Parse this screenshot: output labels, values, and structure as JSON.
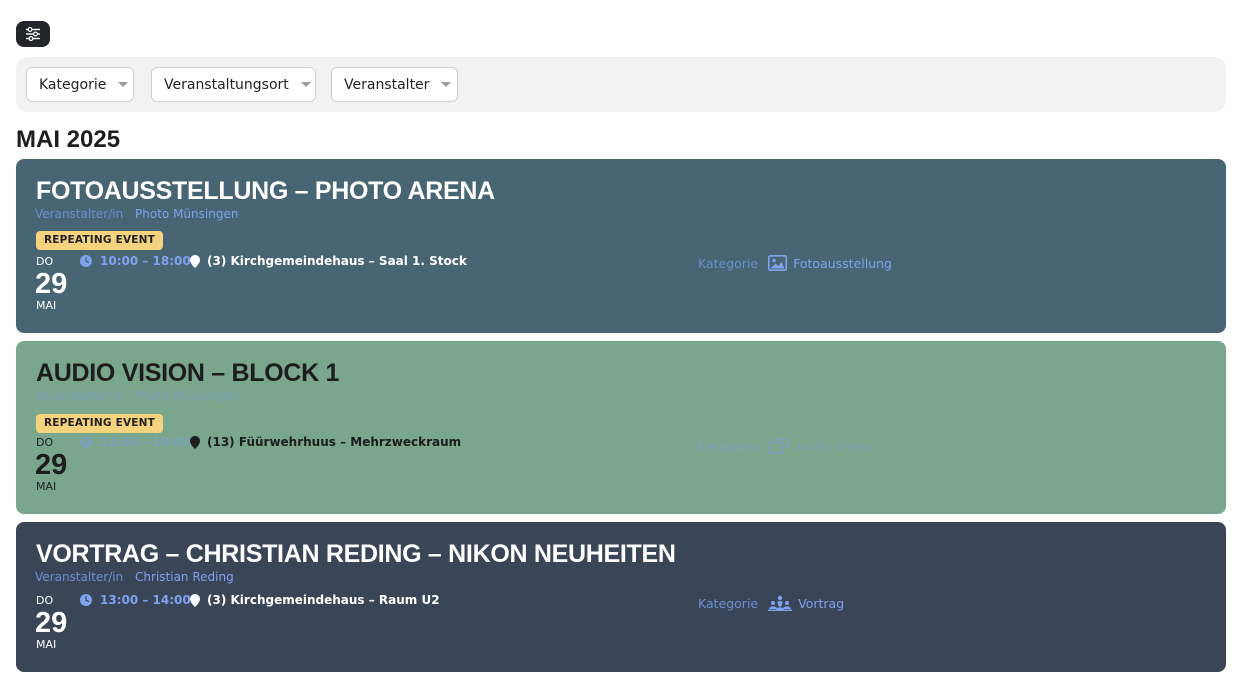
{
  "filters": {
    "toggle_icon": "sliders-icon",
    "dropdowns": [
      {
        "label": "Kategorie"
      },
      {
        "label": "Veranstaltungsort"
      },
      {
        "label": "Veranstalter"
      }
    ]
  },
  "month_title": "MAI 2025",
  "colors": {
    "card_1_bg": "#476573",
    "card_2_bg": "#7aa68d",
    "card_3_bg": "#3a4658",
    "badge_bg": "#f5d27e",
    "link": "#7fa3ef"
  },
  "events": [
    {
      "title": "FOTOAUSSTELLUNG – PHOTO ARENA",
      "organizer_label": "Veranstalter/in",
      "organizer": "Photo Münsingen",
      "badge": "REPEATING EVENT",
      "date": {
        "dow": "DO",
        "day": "29",
        "month": "MAI"
      },
      "time": "10:00 – 18:00",
      "location": "(3) Kirchgemeindehaus – Saal 1. Stock",
      "category_label": "Kategorie",
      "category": "Fotoausstellung",
      "category_icon": "image-icon"
    },
    {
      "title": "AUDIO VISION – BLOCK 1",
      "organizer_label": "Veranstalter/in",
      "organizer": "Photo Münsingen",
      "badge": "REPEATING EVENT",
      "date": {
        "dow": "DO",
        "day": "29",
        "month": "MAI"
      },
      "time": "13:00 – 18:00",
      "location": "(13) Füürwehrhuus – Mehrzweckraum",
      "category_label": "Kategorie",
      "category": "Audio Vision",
      "category_icon": "audio-vision-icon"
    },
    {
      "title": "VORTRAG – CHRISTIAN REDING – NIKON NEUHEITEN",
      "organizer_label": "Veranstalter/in",
      "organizer": "Christian Reding",
      "date": {
        "dow": "DO",
        "day": "29",
        "month": "MAI"
      },
      "time": "13:00 – 14:00",
      "location": "(3) Kirchgemeindehaus – Raum U2",
      "category_label": "Kategorie",
      "category": "Vortrag",
      "category_icon": "audience-icon"
    }
  ]
}
